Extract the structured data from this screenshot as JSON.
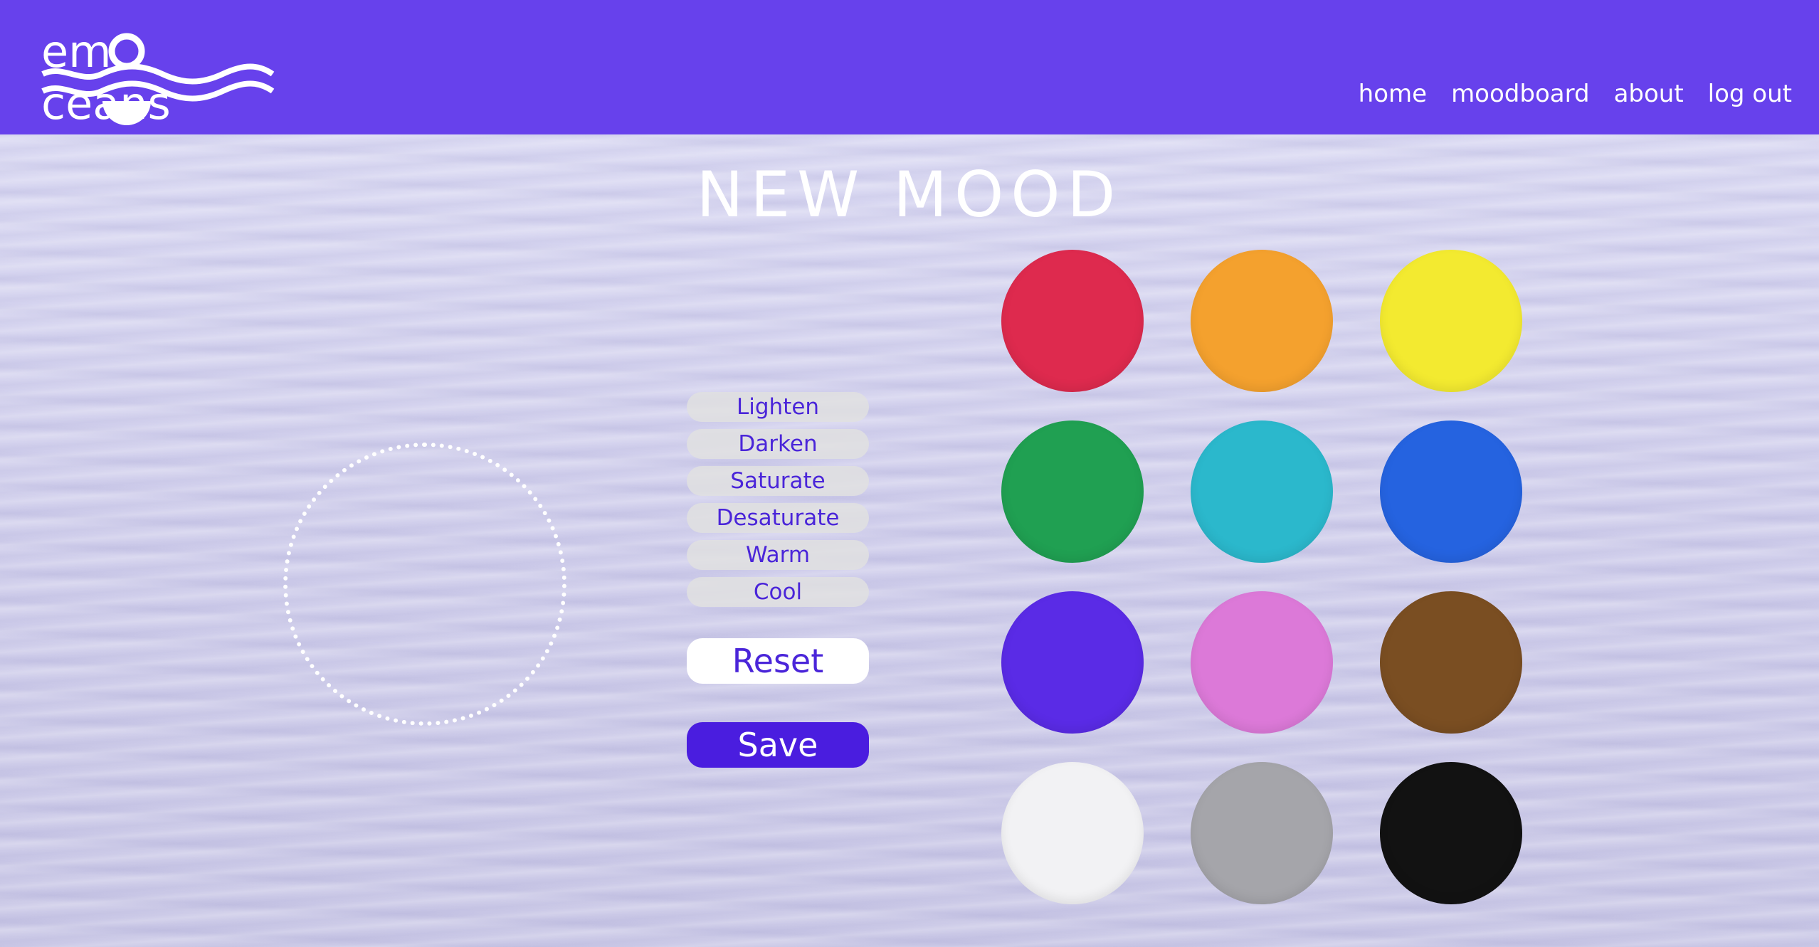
{
  "brand": {
    "name": "emOceans"
  },
  "nav": {
    "items": [
      "home",
      "moodboard",
      "about",
      "log out"
    ]
  },
  "page": {
    "title": "NEW MOOD"
  },
  "adjustments": [
    "Lighten",
    "Darken",
    "Saturate",
    "Desaturate",
    "Warm",
    "Cool"
  ],
  "actions": {
    "reset": "Reset",
    "save": "Save"
  },
  "palette": [
    {
      "name": "red",
      "color": "#de2a4e"
    },
    {
      "name": "orange",
      "color": "#f4a12e"
    },
    {
      "name": "yellow",
      "color": "#f3ea30"
    },
    {
      "name": "green",
      "color": "#20a052"
    },
    {
      "name": "cyan",
      "color": "#2bb8cc"
    },
    {
      "name": "blue",
      "color": "#2563e0"
    },
    {
      "name": "purple",
      "color": "#5a2be6"
    },
    {
      "name": "pink",
      "color": "#dc79d8"
    },
    {
      "name": "brown",
      "color": "#7a4e22"
    },
    {
      "name": "white",
      "color": "#f2f2f4"
    },
    {
      "name": "gray",
      "color": "#a5a5aa"
    },
    {
      "name": "black",
      "color": "#121212"
    }
  ],
  "colors": {
    "header": "#6741ec",
    "accent": "#4a25d9",
    "background": "#d3d2ef"
  }
}
